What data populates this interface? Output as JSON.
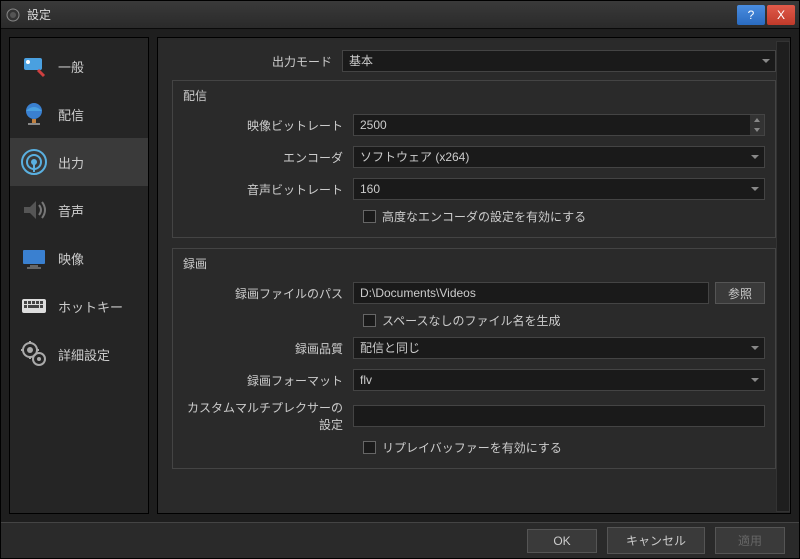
{
  "titlebar": {
    "title": "設定"
  },
  "sidebar": {
    "items": [
      {
        "label": "一般"
      },
      {
        "label": "配信"
      },
      {
        "label": "出力"
      },
      {
        "label": "音声"
      },
      {
        "label": "映像"
      },
      {
        "label": "ホットキー"
      },
      {
        "label": "詳細設定"
      }
    ]
  },
  "output_mode": {
    "label": "出力モード",
    "value": "基本"
  },
  "streaming": {
    "title": "配信",
    "video_bitrate": {
      "label": "映像ビットレート",
      "value": "2500"
    },
    "encoder": {
      "label": "エンコーダ",
      "value": "ソフトウェア (x264)"
    },
    "audio_bitrate": {
      "label": "音声ビットレート",
      "value": "160"
    },
    "advanced": {
      "label": "高度なエンコーダの設定を有効にする"
    }
  },
  "recording": {
    "title": "録画",
    "path": {
      "label": "録画ファイルのパス",
      "value": "D:\\Documents\\Videos",
      "browse": "参照"
    },
    "no_space": {
      "label": "スペースなしのファイル名を生成"
    },
    "quality": {
      "label": "録画品質",
      "value": "配信と同じ"
    },
    "format": {
      "label": "録画フォーマット",
      "value": "flv"
    },
    "muxer": {
      "label": "カスタムマルチプレクサーの設定",
      "value": ""
    },
    "replay": {
      "label": "リプレイバッファーを有効にする"
    }
  },
  "footer": {
    "ok": "OK",
    "cancel": "キャンセル",
    "apply": "適用"
  }
}
